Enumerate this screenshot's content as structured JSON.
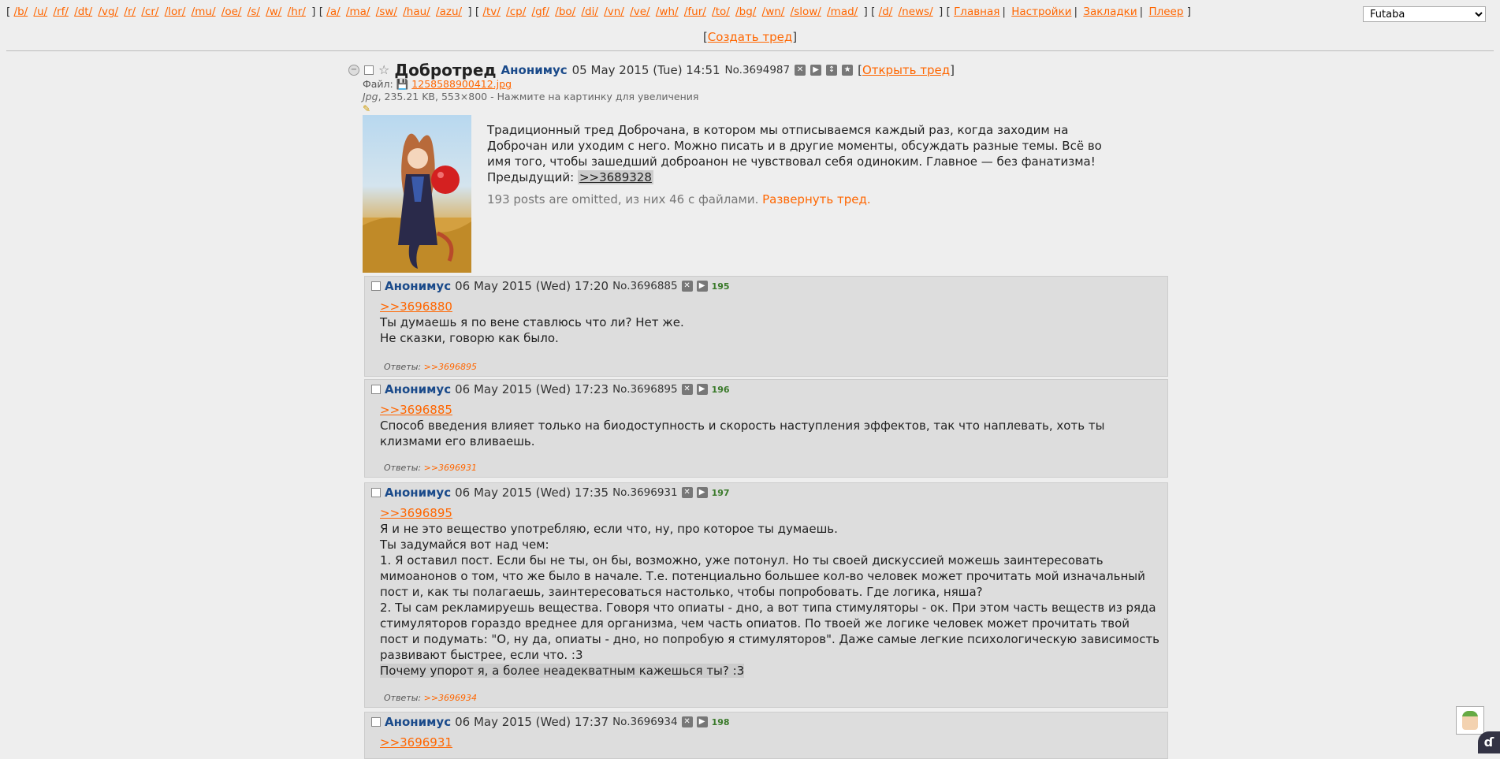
{
  "nav": {
    "groups": [
      [
        "/b/",
        "/u/",
        "/rf/",
        "/dt/",
        "/vg/",
        "/r/",
        "/cr/",
        "/lor/",
        "/mu/",
        "/oe/",
        "/s/",
        "/w/",
        "/hr/"
      ],
      [
        "/a/",
        "/ma/",
        "/sw/",
        "/hau/",
        "/azu/"
      ],
      [
        "/tv/",
        "/cp/",
        "/gf/",
        "/bo/",
        "/di/",
        "/vn/",
        "/ve/",
        "/wh/",
        "/fur/",
        "/to/",
        "/bg/",
        "/wn/",
        "/slow/",
        "/mad/"
      ],
      [
        "/d/",
        "/news/"
      ]
    ],
    "menu": [
      "Главная",
      "Настройки",
      "Закладки",
      "Плеер"
    ],
    "style_select": "Futaba"
  },
  "create_thread": "Создать тред",
  "op": {
    "title": "Добротред",
    "author": "Анонимус",
    "date": "05 May 2015 (Tue) 14:51",
    "number": "No.3694987",
    "open_thread": "Открыть тред",
    "file_label": "Файл:",
    "file_name": "1258588900412.jpg",
    "file_type": "Jpg",
    "file_meta": ", 235.21 KB, 553×800 - Нажмите на картинку для увеличения",
    "body": "Традиционный тред Доброчана, в котором мы отписываемся каждый раз, когда заходим на Доброчан или уходим с него. Можно писать и в другие моменты, обсуждать разные темы. Всё во имя того, чтобы зашедший доброанон не чувствовал себя одиноким. Главное — без фанатизма!",
    "prev_label": "Предыдущий:",
    "prev_link": ">>3689328",
    "omitted": "193 posts are omitted, из них 46 с файлами.",
    "expand": "Развернуть тред."
  },
  "replies_label": "Ответы:",
  "posts": [
    {
      "author": "Анонимус",
      "date": "06 May 2015 (Wed) 17:20",
      "number": "No.3696885",
      "count": "195",
      "quote": ">>3696880",
      "lines": [
        "Ты думаешь я по вене ставлюсь что ли? Нет же.",
        "Не сказки, говорю как было."
      ],
      "replies": ">>3696895"
    },
    {
      "author": "Анонимус",
      "date": "06 May 2015 (Wed) 17:23",
      "number": "No.3696895",
      "count": "196",
      "quote": ">>3696885",
      "lines": [
        "Способ введения влияет только на биодоступность и скорость наступления эффектов, так что наплевать, хоть ты клизмами его вливаешь."
      ],
      "replies": ">>3696931"
    },
    {
      "author": "Анонимус",
      "date": "06 May 2015 (Wed) 17:35",
      "number": "No.3696931",
      "count": "197",
      "quote": ">>3696895",
      "lines": [
        "Я и не это вещество употребляю, если что, ну, про которое ты думаешь.",
        "Ты задумайся вот над чем:",
        "1. Я оставил пост. Если бы не ты, он бы, возможно, уже потонул. Но ты своей дискуссией можешь заинтересовать мимоанонов о том, что же было в начале. Т.е. потенциально большее кол-во человек может прочитать мой изначальный пост и, как ты полагаешь, заинтересоваться настолько, чтобы попробовать. Где логика, няша?",
        "2. Ты сам рекламируешь вещества. Говоря что опиаты - дно, а вот типа стимуляторы - ок. При этом часть веществ из ряда стимуляторов гораздо вреднее для организма, чем часть опиатов. По твоей же логике человек может прочитать твой пост и подумать: \"О, ну да, опиаты - дно, но попробую я стимуляторов\". Даже самые легкие психологическую зависимость развивают быстрее, если что. :3"
      ],
      "highlight": "Почему упорот я, а более неадекватным кажешься ты? :3",
      "replies": ">>3696934"
    },
    {
      "author": "Анонимус",
      "date": "06 May 2015 (Wed) 17:37",
      "number": "No.3696934",
      "count": "198",
      "quote": ">>3696931"
    }
  ]
}
